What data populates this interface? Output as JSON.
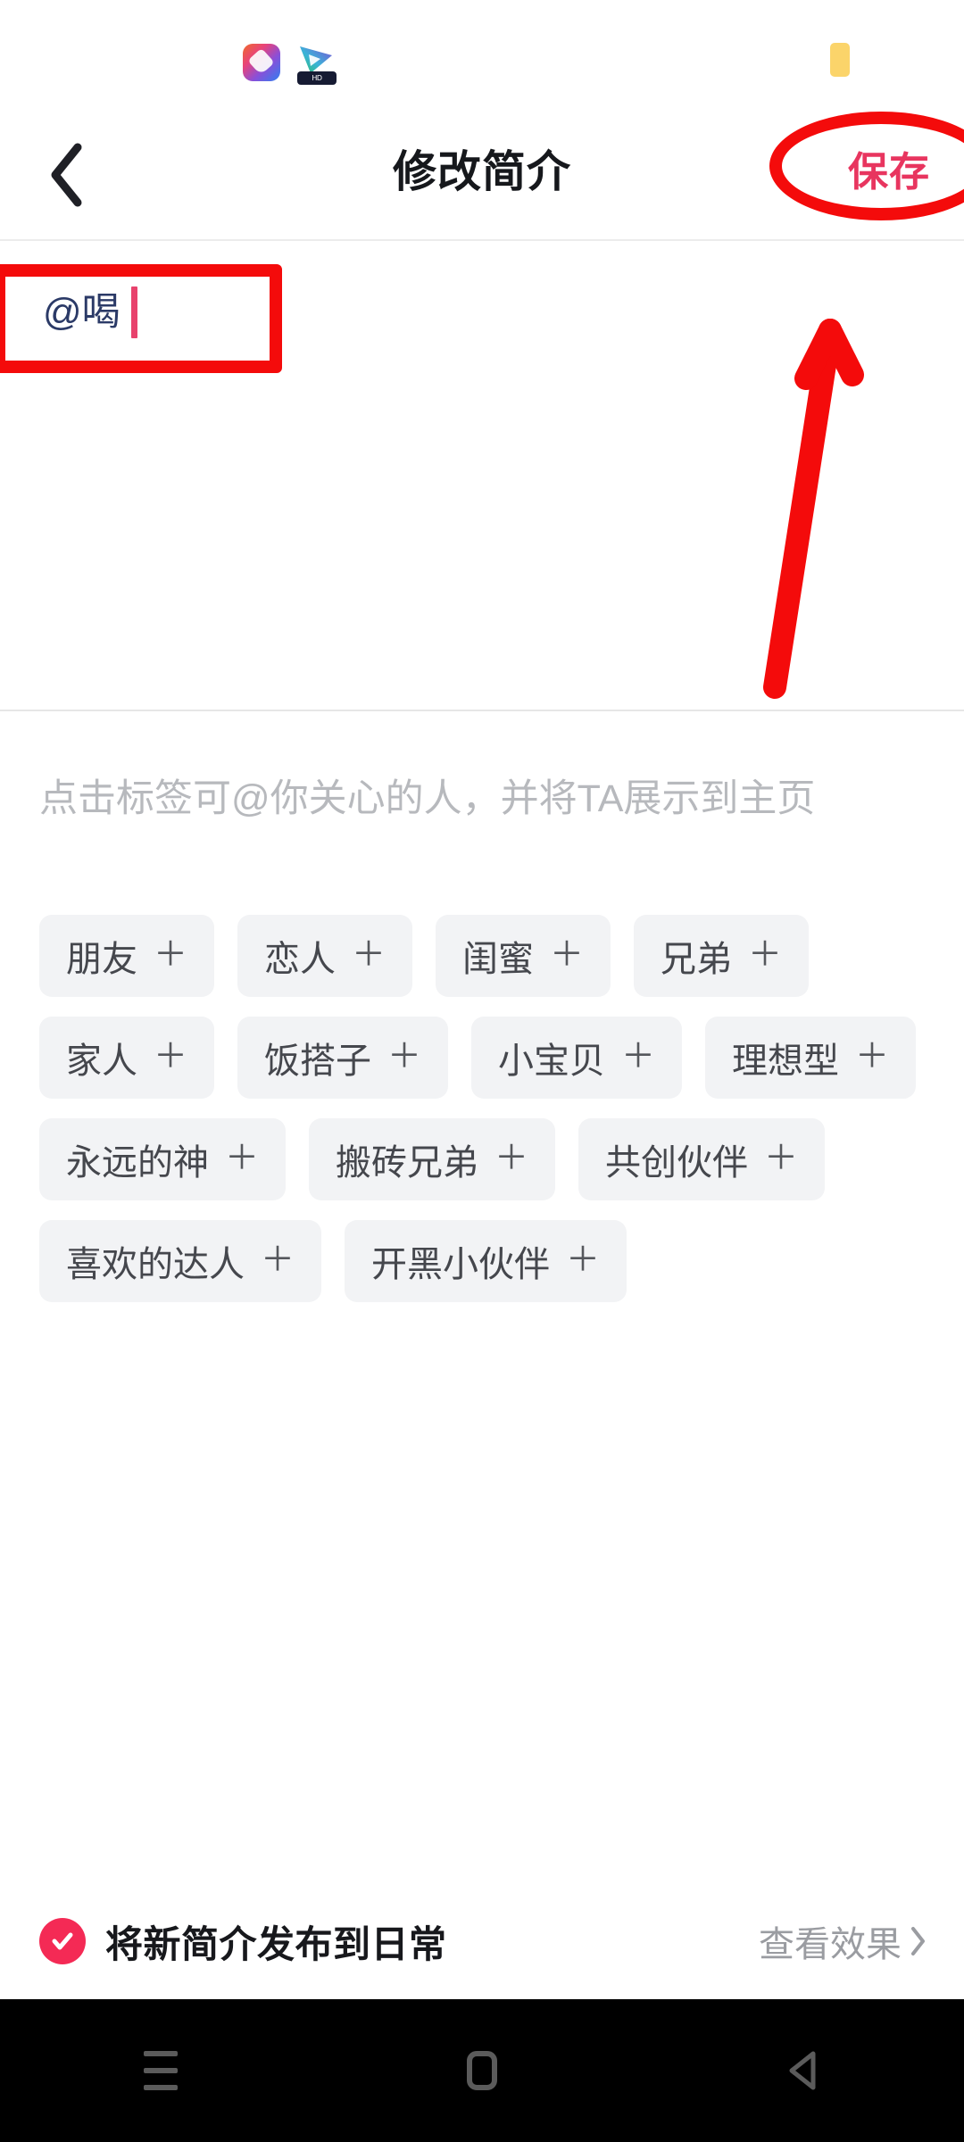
{
  "status_bar": {
    "app_icon_1": "photo-editor-app-icon",
    "app_icon_2": "video-player-app-icon",
    "app_icon_2_badge": "HD",
    "battery_icon": "battery-indicator"
  },
  "header": {
    "back_icon": "back-chevron-icon",
    "title": "修改简介",
    "save_label": "保存",
    "save_color": "#e8355f"
  },
  "bio": {
    "value": "@喝",
    "caret_color": "#e8426d",
    "text_color": "#2b3a67"
  },
  "tags": {
    "hint": "点击标签可@你关心的人，并将TA展示到主页",
    "plus_glyph": "＋",
    "items": [
      {
        "label": "朋友"
      },
      {
        "label": "恋人"
      },
      {
        "label": "闺蜜"
      },
      {
        "label": "兄弟"
      },
      {
        "label": "家人"
      },
      {
        "label": "饭搭子"
      },
      {
        "label": "小宝贝"
      },
      {
        "label": "理想型"
      },
      {
        "label": "永远的神"
      },
      {
        "label": "搬砖兄弟"
      },
      {
        "label": "共创伙伴"
      },
      {
        "label": "喜欢的达人"
      },
      {
        "label": "开黑小伙伴"
      }
    ]
  },
  "bottom_bar": {
    "checkbox_icon": "check-circle-icon",
    "checkbox_checked": true,
    "checkbox_color": "#f42a55",
    "publish_label": "将新简介发布到日常",
    "preview_label": "查看效果",
    "preview_chevron_icon": "chevron-right-icon"
  },
  "nav_bar": {
    "recents_icon": "recents-icon",
    "home_icon": "home-icon",
    "back_icon": "back-triangle-icon"
  },
  "annotations": {
    "color": "#f40b0b",
    "save_highlight": "ellipse-around-save-button",
    "input_highlight": "rect-around-bio-input",
    "arrow": "arrow-pointing-to-save-button"
  }
}
